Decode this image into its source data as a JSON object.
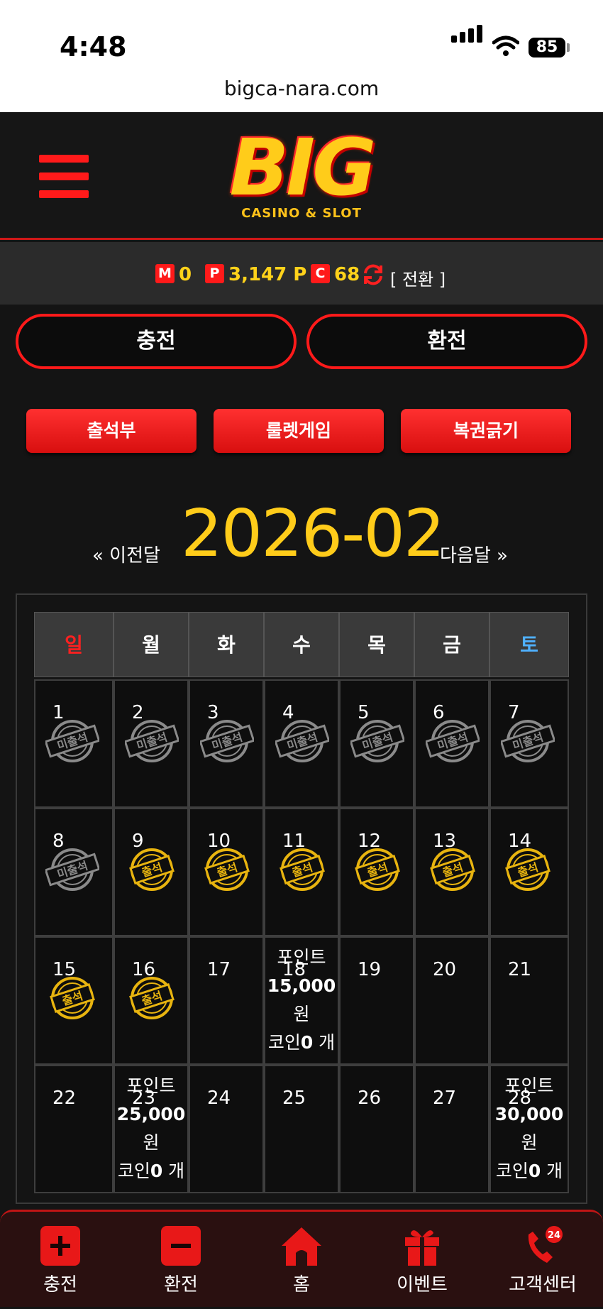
{
  "status_bar": {
    "time": "4:48",
    "battery": "85",
    "url": "bigca-nara.com"
  },
  "logo": {
    "text": "BIG",
    "sub": "CASINO & SLOT"
  },
  "balance": {
    "m_badge": "M",
    "m_value": "0",
    "p_badge": "P",
    "p_value": "3,147 P",
    "c_badge": "C",
    "c_value": "68",
    "swap_label": "[ 전환 ]"
  },
  "actions": {
    "charge": "충전",
    "exchange": "환전"
  },
  "menu_buttons": [
    "출석부",
    "룰렛게임",
    "복권긁기"
  ],
  "calendar": {
    "prev_label": "« 이전달",
    "month": "2026-02",
    "next_label": "다음달 »",
    "weekdays": [
      "일",
      "월",
      "화",
      "수",
      "목",
      "금",
      "토"
    ],
    "weekday_colors": [
      "#ff2020",
      "#ffffff",
      "#ffffff",
      "#ffffff",
      "#ffffff",
      "#ffffff",
      "#4fb0ff"
    ],
    "stamp_missed": "미출석",
    "stamp_attended": "출석",
    "days": [
      {
        "d": "1",
        "stamp": "missed"
      },
      {
        "d": "2",
        "stamp": "missed"
      },
      {
        "d": "3",
        "stamp": "missed"
      },
      {
        "d": "4",
        "stamp": "missed"
      },
      {
        "d": "5",
        "stamp": "missed"
      },
      {
        "d": "6",
        "stamp": "missed"
      },
      {
        "d": "7",
        "stamp": "missed"
      },
      {
        "d": "8",
        "stamp": "missed"
      },
      {
        "d": "9",
        "stamp": "attended"
      },
      {
        "d": "10",
        "stamp": "attended"
      },
      {
        "d": "11",
        "stamp": "attended"
      },
      {
        "d": "12",
        "stamp": "attended"
      },
      {
        "d": "13",
        "stamp": "attended"
      },
      {
        "d": "14",
        "stamp": "attended"
      },
      {
        "d": "15",
        "stamp": "attended"
      },
      {
        "d": "16",
        "stamp": "attended"
      },
      {
        "d": "17"
      },
      {
        "d": "18",
        "reward": {
          "line1": "포인트",
          "amount": "15,000",
          "unit": "원",
          "coin_prefix": "코인",
          "coin": "0",
          "coin_suffix": " 개"
        }
      },
      {
        "d": "19"
      },
      {
        "d": "20"
      },
      {
        "d": "21"
      },
      {
        "d": "22"
      },
      {
        "d": "23",
        "reward": {
          "line1": "포인트",
          "amount": "25,000",
          "unit": "원",
          "coin_prefix": "코인",
          "coin": "0",
          "coin_suffix": " 개"
        }
      },
      {
        "d": "24"
      },
      {
        "d": "25"
      },
      {
        "d": "26"
      },
      {
        "d": "27"
      },
      {
        "d": "28",
        "reward": {
          "line1": "포인트",
          "amount": "30,000",
          "unit": "원",
          "coin_prefix": "코인",
          "coin": "0",
          "coin_suffix": " 개"
        }
      }
    ]
  },
  "tabbar": {
    "items": [
      "충전",
      "환전",
      "홈",
      "이벤트",
      "고객센터"
    ],
    "support_badge": "24"
  },
  "colors": {
    "accent": "#ff1a1a",
    "gold": "#ffcc1a",
    "bg": "#141414"
  }
}
